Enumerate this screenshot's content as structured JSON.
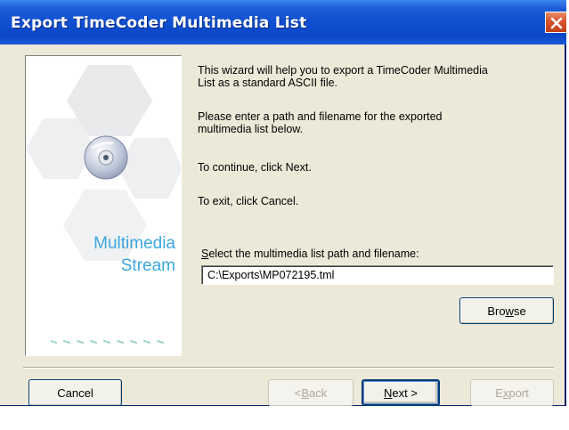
{
  "window": {
    "title": "Export TimeCoder Multimedia List"
  },
  "image_panel": {
    "line1": "Multimedia",
    "line2": "Stream"
  },
  "description": {
    "para1": [
      "This wizard will help you to export a TimeCoder Multimedia",
      "List as a standard ASCII file."
    ],
    "para2": [
      "Please enter a path and filename for the exported",
      "multimedia list below."
    ],
    "para3": "To continue, click Next.",
    "para4": "To exit, click Cancel."
  },
  "path_field": {
    "label_prefix": "S",
    "label_rest": "elect the multimedia list path and filename:",
    "value": "C:\\Exports\\MP072195.tml"
  },
  "buttons": {
    "browse_a": "Bro",
    "browse_key": "w",
    "browse_b": "se",
    "cancel": "Cancel",
    "back_a": "< ",
    "back_key": "B",
    "back_b": "ack",
    "next_key": "N",
    "next_b": "ext >",
    "export_a": "E",
    "export_key": "x",
    "export_b": "port"
  },
  "states": {
    "back_enabled": false,
    "export_enabled": false,
    "default_button": "next"
  },
  "colors": {
    "titlebar": "#0b47c8",
    "accent_text": "#3aa7dd",
    "close_button": "#d8542c"
  },
  "icons": [
    "close-icon",
    "cd-icon"
  ]
}
